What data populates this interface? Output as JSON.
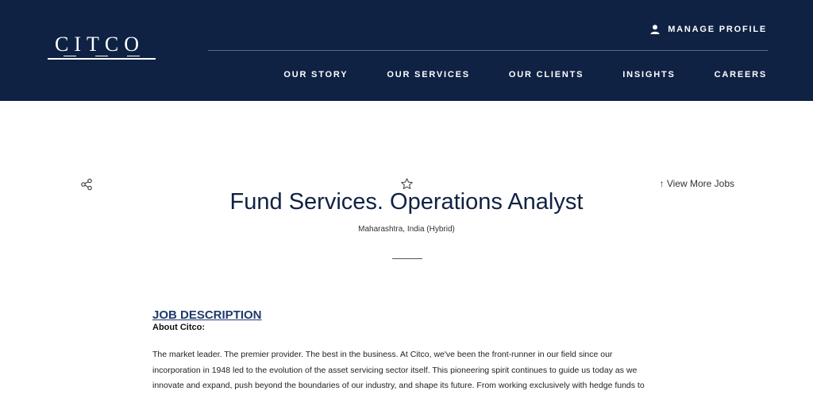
{
  "header": {
    "logo_text": "CITCO",
    "manage_profile": "MANAGE PROFILE",
    "nav": [
      "OUR STORY",
      "OUR SERVICES",
      "OUR CLIENTS",
      "INSIGHTS",
      "CAREERS"
    ]
  },
  "job": {
    "view_more": "↑ View More Jobs",
    "title": "Fund Services. Operations Analyst",
    "location": "Maharashtra, India (Hybrid)"
  },
  "description": {
    "heading": "JOB DESCRIPTION",
    "subheading": "About Citco:",
    "paragraph": "The market leader. The premier provider. The best in the business. At Citco, we've been the front-runner in our field since our incorporation in 1948 led to the evolution of the asset servicing sector itself. This pioneering spirit continues to guide us today as we innovate and expand, push beyond the boundaries of our industry, and shape its future. From working exclusively with hedge funds to serving all alternatives, corporations and private clients, our organization has grown immensely across asset classes and geographies."
  },
  "colors": {
    "header_bg": "#0f2244",
    "heading_blue": "#1f3a6e"
  }
}
